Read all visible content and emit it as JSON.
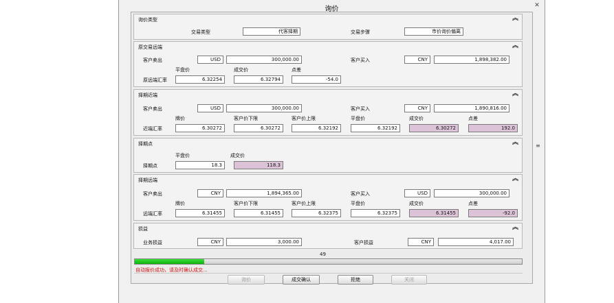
{
  "window": {
    "title": "询价",
    "close": "✕"
  },
  "icons": {
    "collapse": "chevron-double-up-icon",
    "close": "close-icon"
  },
  "sections": {
    "inquiry_type": {
      "title": "询价类型",
      "trade_type_label": "交易类型",
      "trade_type_value": "代客择期",
      "trade_step_label": "交易步骤",
      "trade_step_value": "市价询价偏离"
    },
    "original_far": {
      "title": "原交易远端",
      "sell_label": "客户卖出",
      "sell_ccy": "USD",
      "sell_amount": "300,000.00",
      "buy_label": "客户买入",
      "buy_ccy": "CNY",
      "buy_amount": "1,898,382.00",
      "flat_label": "平盘价",
      "deal_label": "成交价",
      "spread_label": "点差",
      "rate_label": "原远端汇率",
      "flat_value": "6.32254",
      "deal_value": "6.32794",
      "spread_value": "-54.0"
    },
    "near": {
      "title": "择期近端",
      "sell_label": "客户卖出",
      "sell_ccy": "USD",
      "sell_amount": "300,000.00",
      "buy_label": "客户买入",
      "buy_ccy": "CNY",
      "buy_amount": "1,890,816.00",
      "quote_label": "牌价",
      "lower_label": "客户价下限",
      "upper_label": "客户价上限",
      "flat_label": "平盘价",
      "deal_label": "成交价",
      "spread_label": "点差",
      "rate_label": "近端汇率",
      "quote_value": "6.30272",
      "lower_value": "6.30272",
      "upper_value": "6.32192",
      "flat_value": "6.32192",
      "deal_value": "6.30272",
      "spread_value": "192.0"
    },
    "points": {
      "title": "择期点",
      "flat_label": "平盘价",
      "deal_label": "成交价",
      "row_label": "择期点",
      "flat_value": "18.3",
      "deal_value": "118.3"
    },
    "far": {
      "title": "择期远端",
      "sell_label": "客户卖出",
      "sell_ccy": "CNY",
      "sell_amount": "1,894,365.00",
      "buy_label": "客户买入",
      "buy_ccy": "USD",
      "buy_amount": "300,000.00",
      "quote_label": "牌价",
      "lower_label": "客户价下限",
      "upper_label": "客户价上限",
      "flat_label": "平盘价",
      "deal_label": "成交价",
      "spread_label": "点差",
      "rate_label": "远端汇率",
      "quote_value": "6.31455",
      "lower_value": "6.31455",
      "upper_value": "6.32375",
      "flat_value": "6.32375",
      "deal_value": "6.31455",
      "spread_value": "-92.0"
    },
    "pnl": {
      "title": "损益",
      "biz_label": "业务损益",
      "biz_ccy": "CNY",
      "biz_value": "3,000.00",
      "cust_label": "客户损益",
      "cust_ccy": "CNY",
      "cust_value": "4,017.00"
    }
  },
  "progress": {
    "counter": "49",
    "fraction": 0.18
  },
  "status": "自动报价成功，请及时确认成交...",
  "buttons": {
    "inquiry": "询价",
    "confirm": "成交确认",
    "reject": "拒绝",
    "close": "关闭"
  },
  "colors": {
    "highlight": "#dcc3d8",
    "progress": "#22c922",
    "status_text": "#d21010"
  }
}
